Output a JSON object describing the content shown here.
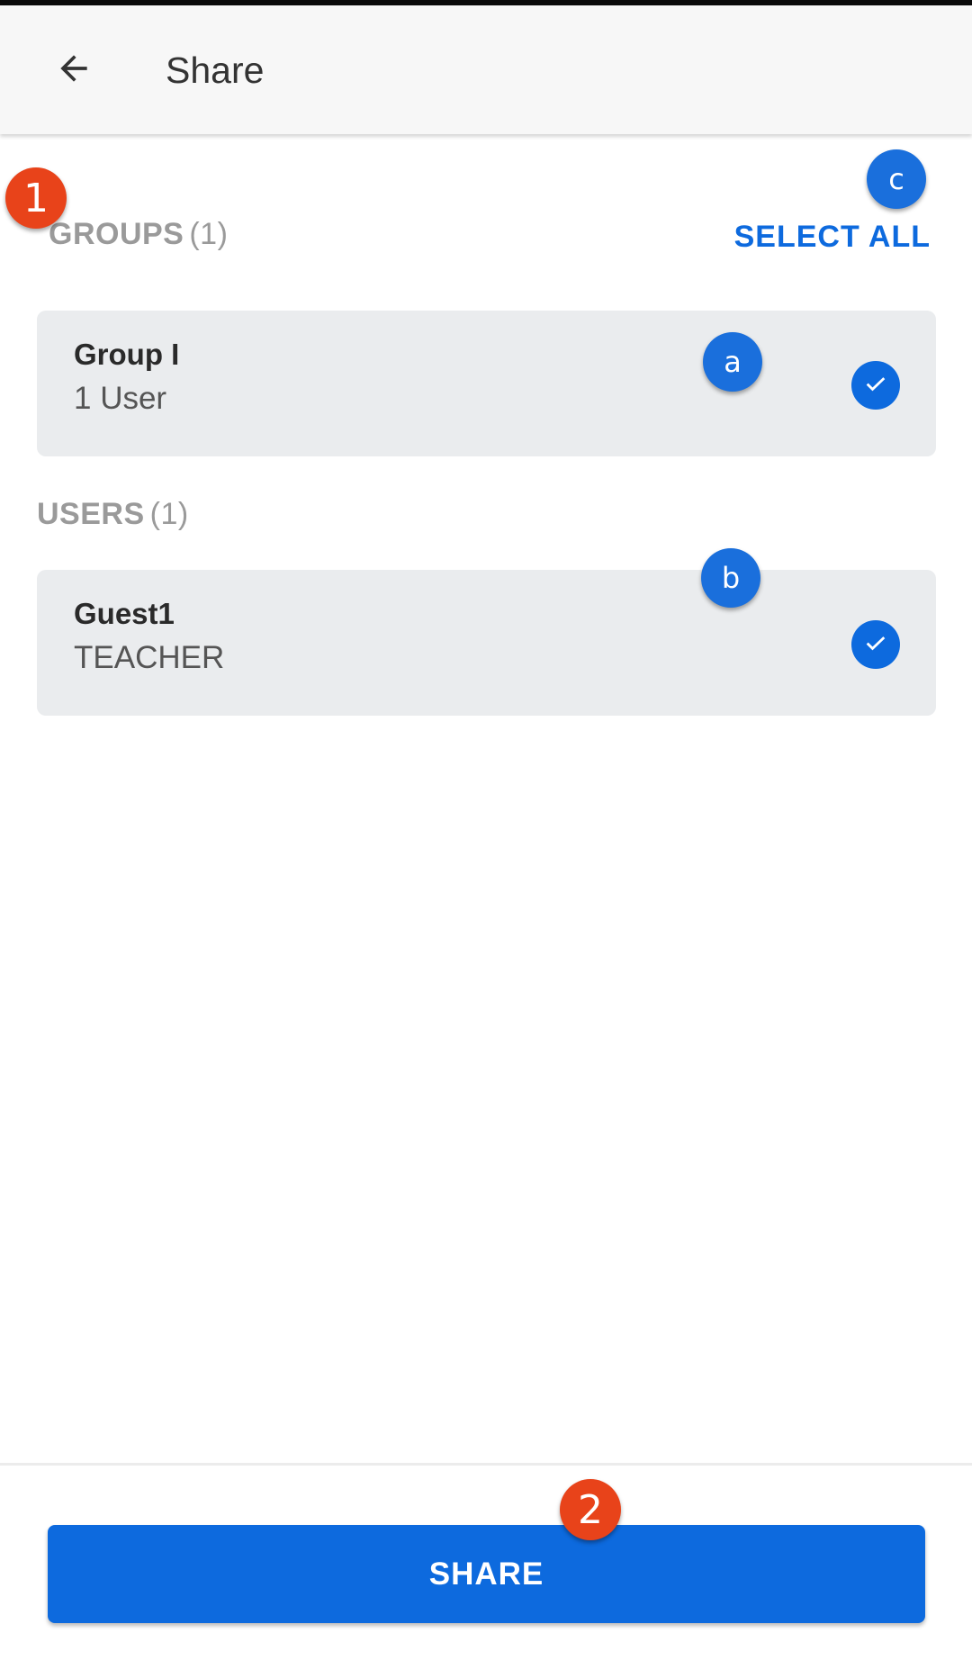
{
  "header": {
    "title": "Share",
    "back_icon": "arrow-left-icon"
  },
  "groups_section": {
    "label": "GROUPS",
    "count": "(1)",
    "select_all_label": "SELECT ALL",
    "items": [
      {
        "title": "Group I",
        "subtitle": "1 User",
        "selected": true
      }
    ]
  },
  "users_section": {
    "label": "USERS",
    "count": "(1)",
    "items": [
      {
        "title": "Guest1",
        "subtitle": "TEACHER",
        "selected": true
      }
    ]
  },
  "footer": {
    "share_label": "SHARE"
  },
  "annotations": {
    "marker_1": "1",
    "marker_2": "2",
    "marker_a": "a",
    "marker_b": "b",
    "marker_c": "c"
  },
  "colors": {
    "accent": "#0d6ade",
    "marker_red": "#e8431a",
    "marker_blue": "#1a6fdc",
    "card_bg": "#eaecee"
  }
}
